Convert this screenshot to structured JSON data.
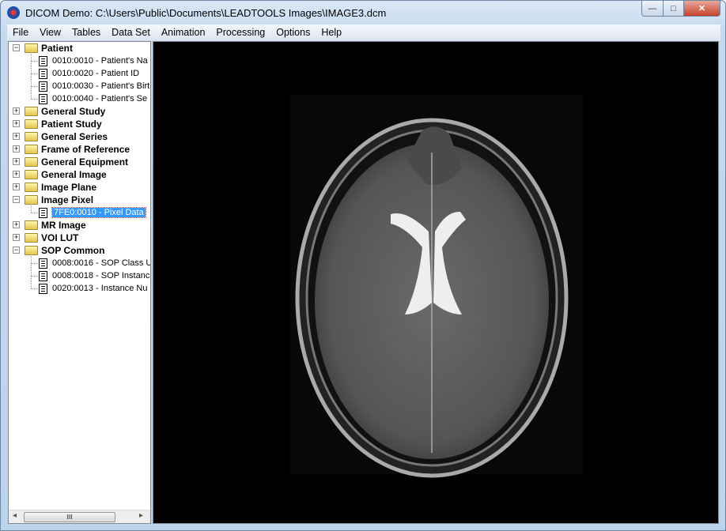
{
  "window": {
    "title": "DICOM Demo: C:\\Users\\Public\\Documents\\LEADTOOLS Images\\IMAGE3.dcm",
    "minimize": "—",
    "maximize": "□",
    "close": "✕"
  },
  "menu": [
    "File",
    "View",
    "Tables",
    "Data Set",
    "Animation",
    "Processing",
    "Options",
    "Help"
  ],
  "tree": [
    {
      "label": "Patient",
      "expanded": true,
      "children": [
        "0010:0010 - Patient's Na",
        "0010:0020 - Patient ID",
        "0010:0030 - Patient's Birt",
        "0010:0040 - Patient's Se"
      ]
    },
    {
      "label": "General Study"
    },
    {
      "label": "Patient Study"
    },
    {
      "label": "General Series"
    },
    {
      "label": "Frame of Reference"
    },
    {
      "label": "General Equipment"
    },
    {
      "label": "General Image"
    },
    {
      "label": "Image Plane"
    },
    {
      "label": "Image Pixel",
      "expanded": true,
      "children": [
        "7FE0:0010 - Pixel Data"
      ]
    },
    {
      "label": "MR Image"
    },
    {
      "label": "VOI LUT"
    },
    {
      "label": "SOP Common",
      "expanded": true,
      "children": [
        "0008:0016 - SOP Class U",
        "0008:0018 - SOP Instanc",
        "0020:0013 - Instance Nu"
      ]
    }
  ],
  "selected": "7FE0:0010 - Pixel Data",
  "scrollbar": {
    "thumb": "III",
    "left": "◂",
    "right": "▸"
  },
  "expand_symbols": {
    "expanded": "−",
    "collapsed": "+"
  }
}
